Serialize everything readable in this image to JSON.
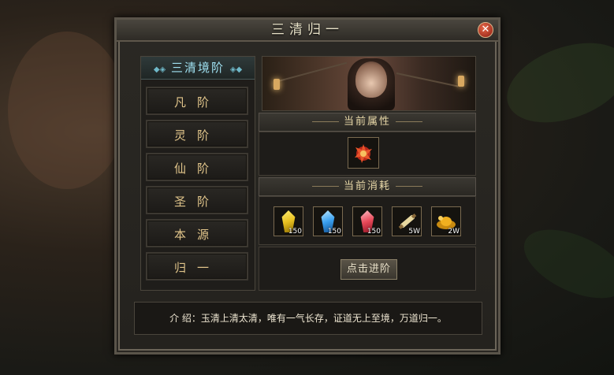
{
  "window": {
    "title": "三清归一"
  },
  "sidebar": {
    "header": "三清境阶",
    "items": [
      {
        "label": "凡阶"
      },
      {
        "label": "灵阶"
      },
      {
        "label": "仙阶"
      },
      {
        "label": "圣阶"
      },
      {
        "label": "本源"
      },
      {
        "label": "归一"
      }
    ]
  },
  "attributes": {
    "title": "当前属性",
    "icon": "fire-flower-icon"
  },
  "costs": {
    "title": "当前消耗",
    "items": [
      {
        "icon": "gold-crystal-icon",
        "count": "150",
        "color": "#e8c020"
      },
      {
        "icon": "blue-crystal-icon",
        "count": "150",
        "color": "#3aa0f0"
      },
      {
        "icon": "red-crystal-icon",
        "count": "150",
        "color": "#e84a5a"
      },
      {
        "icon": "scroll-icon",
        "count": "5W",
        "color": "#e8d8a0"
      },
      {
        "icon": "gold-ingot-icon",
        "count": "2W",
        "color": "#f0b020"
      }
    ]
  },
  "actions": {
    "advance_label": "点击进阶"
  },
  "intro": {
    "text": "介 绍：玉清上清太清，唯有一气长存，证道无上至境，万道归一。"
  }
}
